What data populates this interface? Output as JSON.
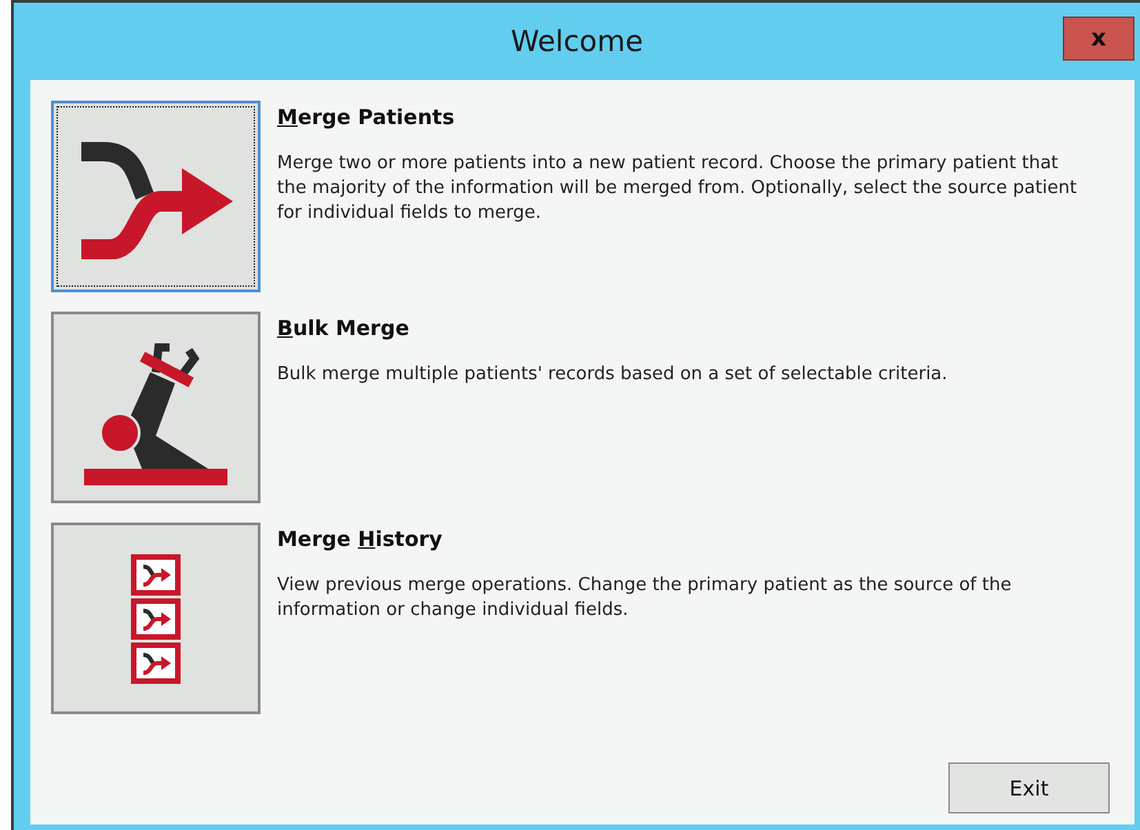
{
  "window": {
    "title": "Welcome",
    "close_label": "x"
  },
  "options": [
    {
      "kind": "merge",
      "title": [
        {
          "text": "M",
          "underlined": true
        },
        {
          "text": "erge Patients",
          "underlined": false
        }
      ],
      "selected": true,
      "description": "Merge two or more patients into a new patient record. Choose the primary patient that the majority of the information will be merged from. Optionally, select the source patient for individual fields to merge."
    },
    {
      "kind": "bulk",
      "title": [
        {
          "text": "B",
          "underlined": true
        },
        {
          "text": "ulk Merge",
          "underlined": false
        }
      ],
      "selected": false,
      "description": "Bulk merge multiple patients' records based on a set of selectable criteria."
    },
    {
      "kind": "history",
      "title": [
        {
          "text": "Merge ",
          "underlined": false
        },
        {
          "text": "H",
          "underlined": true
        },
        {
          "text": "istory",
          "underlined": false
        }
      ],
      "selected": false,
      "description": "View previous merge operations. Change the primary patient as the source of the information or change individual fields."
    }
  ],
  "buttons": [
    {
      "label": "Exit"
    }
  ]
}
